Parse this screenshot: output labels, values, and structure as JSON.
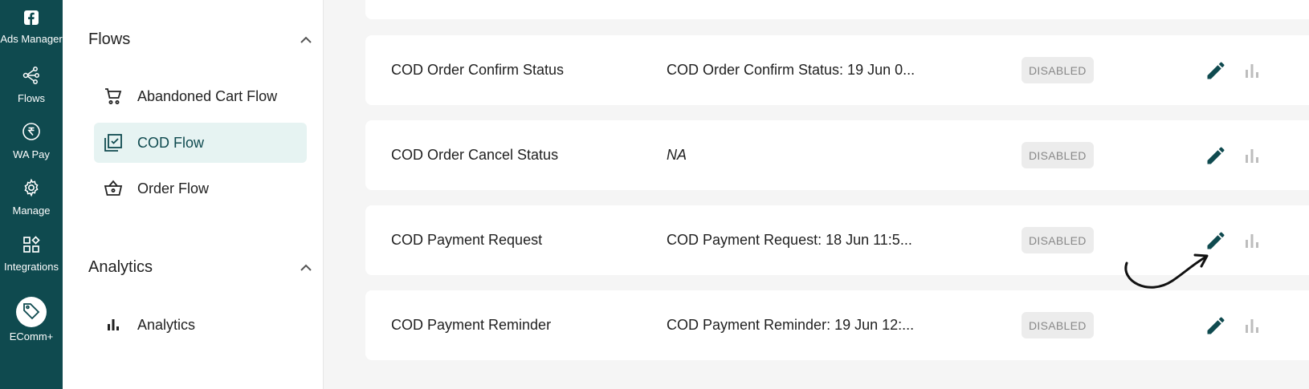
{
  "rail": {
    "items": [
      {
        "label": "Ads Manager",
        "icon": "facebook-icon"
      },
      {
        "label": "Flows",
        "icon": "flows-icon"
      },
      {
        "label": "WA Pay",
        "icon": "rupee-icon"
      },
      {
        "label": "Manage",
        "icon": "gear-icon"
      },
      {
        "label": "Integrations",
        "icon": "grid-icon"
      },
      {
        "label": "EComm+",
        "icon": "tag-icon",
        "active": true
      }
    ]
  },
  "sidebar": {
    "flows_title": "Flows",
    "flows_items": [
      {
        "label": "Abandoned Cart Flow",
        "icon": "cart-icon"
      },
      {
        "label": "COD Flow",
        "icon": "checklist-icon",
        "active": true
      },
      {
        "label": "Order Flow",
        "icon": "basket-icon"
      }
    ],
    "analytics_title": "Analytics",
    "analytics_items": [
      {
        "label": "Analytics",
        "icon": "bar-chart-icon"
      }
    ]
  },
  "flows": [
    {
      "name": "COD Order Confirm Status",
      "desc": "COD Order Confirm Status: 19 Jun 0...",
      "status": "DISABLED"
    },
    {
      "name": "COD Order Cancel Status",
      "desc": "NA",
      "status": "DISABLED"
    },
    {
      "name": "COD Payment Request",
      "desc": "COD Payment Request: 18 Jun 11:5...",
      "status": "DISABLED"
    },
    {
      "name": "COD Payment Reminder",
      "desc": "COD Payment Reminder: 19 Jun 12:...",
      "status": "DISABLED"
    }
  ],
  "colors": {
    "brand": "#0f4a4f",
    "active_bg": "#e6f3f2",
    "badge_bg": "#ececec",
    "badge_text": "#888888"
  }
}
